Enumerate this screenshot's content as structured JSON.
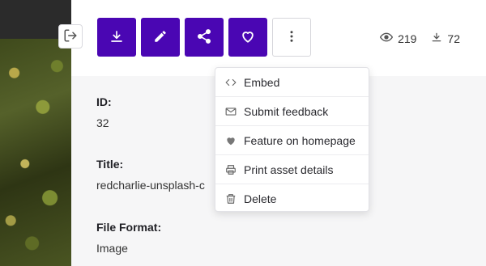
{
  "actions": {
    "download": "download-icon",
    "edit": "pencil-icon",
    "share": "share-icon",
    "favorite": "heart-icon",
    "more": "more-vertical-icon"
  },
  "stats": {
    "views": "219",
    "downloads": "72"
  },
  "fields": [
    {
      "label": "ID:",
      "value": "32"
    },
    {
      "label": "Title:",
      "value": "redcharlie-unsplash-c"
    },
    {
      "label": "File Format:",
      "value": "Image"
    }
  ],
  "menu": {
    "items": [
      {
        "label": "Embed",
        "icon": "code-icon"
      },
      {
        "label": "Submit feedback",
        "icon": "mail-icon"
      },
      {
        "label": "Feature on homepage",
        "icon": "heart-filled-icon"
      },
      {
        "label": "Print asset details",
        "icon": "printer-icon"
      },
      {
        "label": "Delete",
        "icon": "trash-icon"
      }
    ]
  },
  "colors": {
    "accent": "#4a06b3"
  }
}
